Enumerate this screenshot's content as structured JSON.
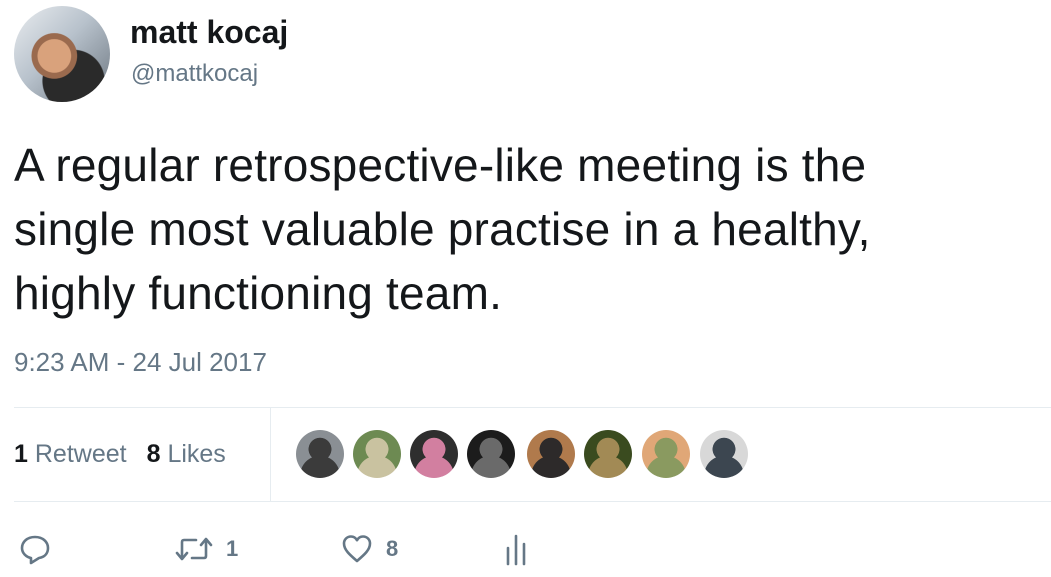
{
  "author": {
    "name": "matt kocaj",
    "handle": "@mattkocaj"
  },
  "tweet": {
    "lines": [
      "A regular retrospective-like meeting is the",
      "single most valuable practise in a healthy,",
      "highly functioning team."
    ],
    "timestamp": "9:23 AM - 24 Jul 2017"
  },
  "stats": {
    "retweet_count": "1",
    "retweet_label": "Retweet",
    "like_count": "8",
    "like_label": "Likes"
  },
  "likers": [
    {
      "icon": "avatar-1",
      "colors": [
        "#8a8f94",
        "#3b3b3b"
      ]
    },
    {
      "icon": "avatar-2",
      "colors": [
        "#6d8a52",
        "#c9c2a0"
      ]
    },
    {
      "icon": "avatar-3",
      "colors": [
        "#2e2e2e",
        "#d27fa0"
      ]
    },
    {
      "icon": "avatar-4",
      "colors": [
        "#1c1c1c",
        "#6a6a6a"
      ]
    },
    {
      "icon": "avatar-5",
      "colors": [
        "#b07a4c",
        "#2d2a2a"
      ]
    },
    {
      "icon": "avatar-6",
      "colors": [
        "#3a4b1f",
        "#a28a55"
      ]
    },
    {
      "icon": "avatar-7",
      "colors": [
        "#e0a777",
        "#8a9a60"
      ]
    },
    {
      "icon": "avatar-8",
      "colors": [
        "#d8d8d8",
        "#3c4650"
      ]
    }
  ],
  "actions": {
    "reply_icon": "reply-icon",
    "retweet_icon": "retweet-icon",
    "retweet_count": "1",
    "like_icon": "heart-icon",
    "like_count": "8",
    "analytics_icon": "analytics-icon"
  },
  "colors": {
    "text": "#14171a",
    "secondary": "#657786",
    "divider": "#e6ecf0"
  }
}
